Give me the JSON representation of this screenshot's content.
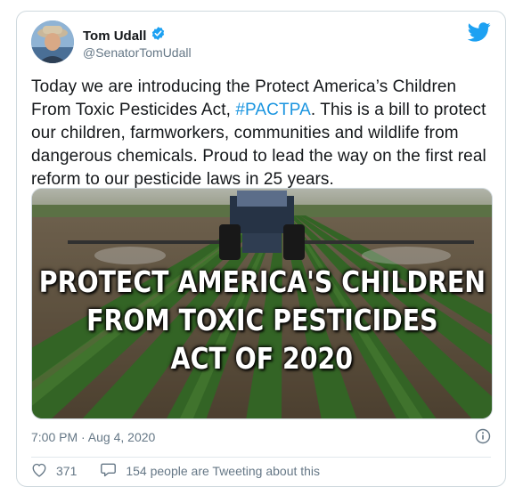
{
  "tweet": {
    "author_name": "Tom Udall",
    "author_handle": "@SenatorTomUdall",
    "text_before": "Today we are introducing the Protect America’s Children From Toxic Pesticides Act, ",
    "hashtag": "#PACTPA",
    "text_after": ". This is a bill to protect our children, farmworkers, communities and wildlife from dangerous chemicals. Proud to lead the way on the first real reform to our pesticide laws in 25 years.",
    "timestamp": "7:00 PM · Aug 4, 2020",
    "media_headline": [
      "PROTECT AMERICA'S CHILDREN",
      "FROM TOXIC PESTICIDES",
      "ACT OF 2020"
    ],
    "like_count": "371",
    "reply_text": "154 people are Tweeting about this"
  },
  "colors": {
    "link": "#1b95e0",
    "verified": "#1da1f2",
    "twitter_brand": "#1da1f2",
    "muted": "#657786"
  },
  "icons": {
    "verified": "verified-badge-icon",
    "brand": "twitter-bird-icon",
    "info": "info-icon",
    "like": "heart-icon",
    "reply": "speech-bubble-icon"
  }
}
